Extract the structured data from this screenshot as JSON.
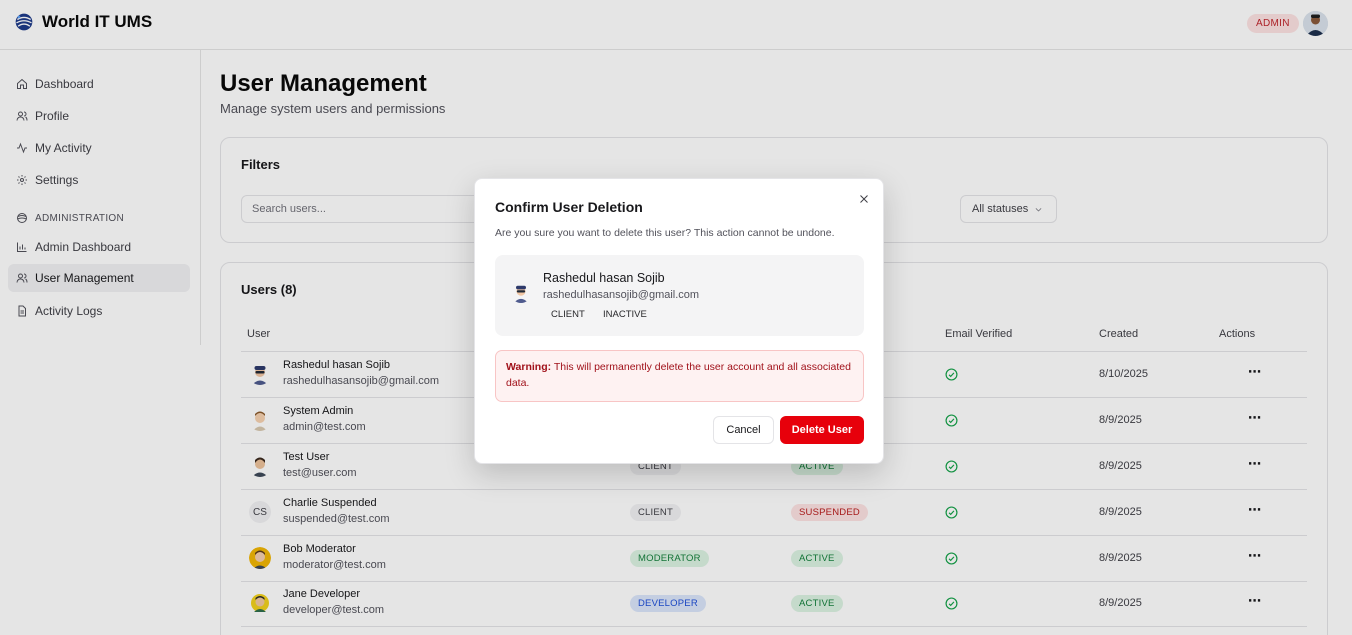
{
  "app": {
    "title": "World IT UMS"
  },
  "header": {
    "role_badge": "ADMIN"
  },
  "sidebar": {
    "items": [
      {
        "label": "Dashboard",
        "icon": "home-icon"
      },
      {
        "label": "Profile",
        "icon": "users-icon"
      },
      {
        "label": "My Activity",
        "icon": "activity-icon"
      },
      {
        "label": "Settings",
        "icon": "gear-icon"
      }
    ],
    "section_label": "ADMINISTRATION",
    "admin_items": [
      {
        "label": "Admin Dashboard",
        "icon": "bar-chart-icon"
      },
      {
        "label": "User Management",
        "icon": "users-icon",
        "active": true
      },
      {
        "label": "Activity Logs",
        "icon": "file-icon"
      }
    ]
  },
  "main": {
    "title": "User Management",
    "subtitle": "Manage system users and permissions",
    "filters": {
      "title": "Filters",
      "search_placeholder": "Search users...",
      "status_select": "All statuses"
    },
    "users": {
      "title": "Users (8)",
      "columns": {
        "user": "User",
        "email_verified": "Email Verified",
        "created": "Created",
        "actions": "Actions"
      },
      "rows": [
        {
          "name": "Rashedul hasan Sojib",
          "email": "rashedulhasansojib@gmail.com",
          "role": "",
          "status": "",
          "created": "8/10/2025",
          "verified": true
        },
        {
          "name": "System Admin",
          "email": "admin@test.com",
          "role": "",
          "status": "",
          "created": "8/9/2025",
          "verified": true
        },
        {
          "name": "Test User",
          "email": "test@user.com",
          "role": "CLIENT",
          "status": "ACTIVE",
          "created": "8/9/2025",
          "verified": true
        },
        {
          "name": "Charlie Suspended",
          "email": "suspended@test.com",
          "initials": "CS",
          "role": "CLIENT",
          "status": "SUSPENDED",
          "created": "8/9/2025",
          "verified": true
        },
        {
          "name": "Bob Moderator",
          "email": "moderator@test.com",
          "role": "MODERATOR",
          "status": "ACTIVE",
          "created": "8/9/2025",
          "verified": true
        },
        {
          "name": "Jane Developer",
          "email": "developer@test.com",
          "role": "DEVELOPER",
          "status": "ACTIVE",
          "created": "8/9/2025",
          "verified": true
        }
      ],
      "actions_glyph": "⋯"
    }
  },
  "modal": {
    "title": "Confirm User Deletion",
    "description": "Are you sure you want to delete this user? This action cannot be undone.",
    "user": {
      "name": "Rashedul hasan Sojib",
      "email": "rashedulhasansojib@gmail.com",
      "role": "CLIENT",
      "status": "INACTIVE"
    },
    "warning_label": "Warning:",
    "warning_text": " This will permanently delete the user account and all associated data.",
    "cancel_label": "Cancel",
    "delete_label": "Delete User"
  },
  "colors": {
    "accent_danger": "#e7000b",
    "pill_client_bg": "#f1f1f3",
    "pill_moderator_bg": "#dcf3e3",
    "pill_developer_bg": "#dbe6fb",
    "pill_active_bg": "#dcf3e3",
    "pill_suspended_bg": "#fde2e2",
    "verified_green": "#16a34a"
  }
}
